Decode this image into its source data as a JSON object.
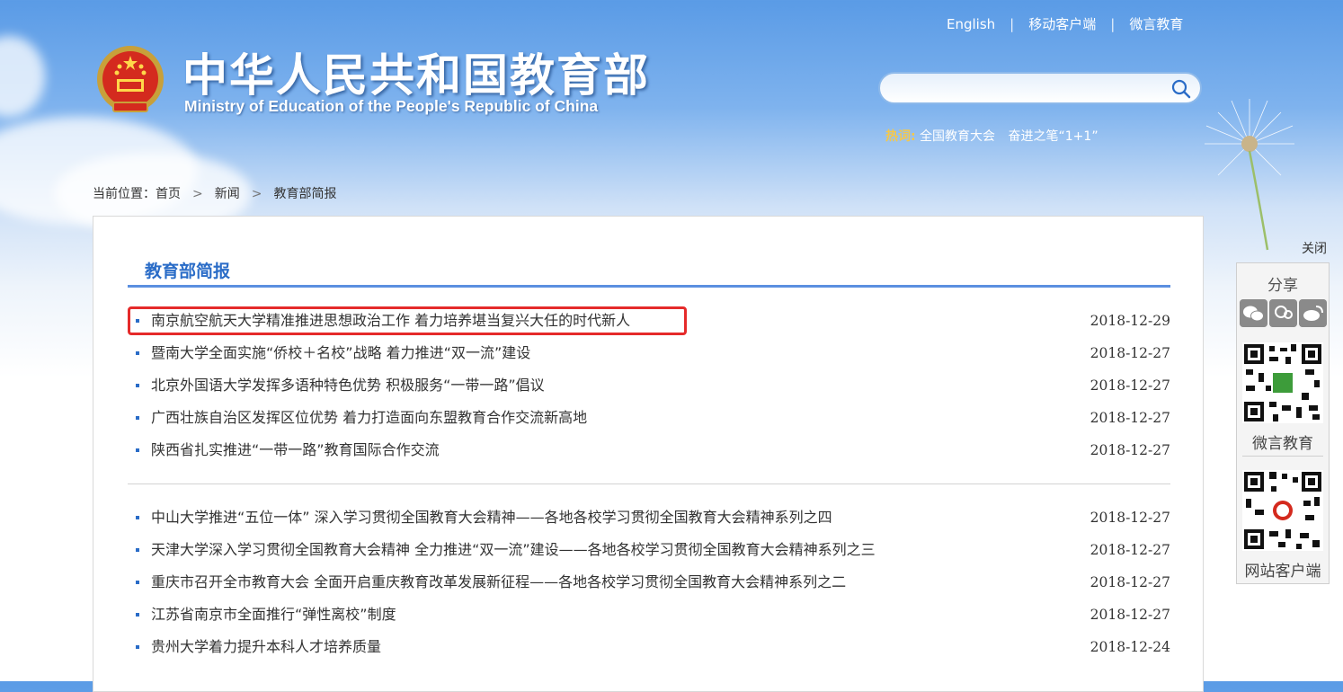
{
  "topnav": {
    "english": "English",
    "mobile_client": "移动客户端",
    "weiyan": "微言教育",
    "separator": "|"
  },
  "site": {
    "title": "中华人民共和国教育部",
    "subtitle": "Ministry of Education of the People's Republic of China"
  },
  "search": {
    "placeholder": "",
    "icon": "search-icon"
  },
  "hotwords": {
    "label": "热词:",
    "items": [
      "全国教育大会",
      "奋进之笔“1+1”"
    ]
  },
  "breadcrumb": {
    "prefix": "当前位置：",
    "home": "首页",
    "news": "新闻",
    "current": "教育部简报",
    "arrow": ">"
  },
  "section": {
    "title": "教育部简报"
  },
  "news_group1": [
    {
      "title": "南京航空航天大学精准推进思想政治工作 着力培养堪当复兴大任的时代新人",
      "date": "2018-12-29"
    },
    {
      "title": "暨南大学全面实施“侨校＋名校”战略 着力推进“双一流”建设",
      "date": "2018-12-27"
    },
    {
      "title": "北京外国语大学发挥多语种特色优势 积极服务“一带一路”倡议",
      "date": "2018-12-27"
    },
    {
      "title": "广西壮族自治区发挥区位优势 着力打造面向东盟教育合作交流新高地",
      "date": "2018-12-27"
    },
    {
      "title": "陕西省扎实推进“一带一路”教育国际合作交流",
      "date": "2018-12-27"
    }
  ],
  "news_group2": [
    {
      "title": "中山大学推进“五位一体” 深入学习贯彻全国教育大会精神——各地各校学习贯彻全国教育大会精神系列之四",
      "date": "2018-12-27"
    },
    {
      "title": "天津大学深入学习贯彻全国教育大会精神 全力推进“双一流”建设——各地各校学习贯彻全国教育大会精神系列之三",
      "date": "2018-12-27"
    },
    {
      "title": "重庆市召开全市教育大会 全面开启重庆教育改革发展新征程——各地各校学习贯彻全国教育大会精神系列之二",
      "date": "2018-12-27"
    },
    {
      "title": "江苏省南京市全面推行“弹性离校”制度",
      "date": "2018-12-27"
    },
    {
      "title": "贵州大学着力提升本科人才培养质量",
      "date": "2018-12-24"
    }
  ],
  "side": {
    "close": "关闭",
    "share": "分享",
    "share_icons": [
      "wechat-icon",
      "qq-icon",
      "weibo-icon"
    ],
    "qr1_label": "微言教育",
    "qr2_label": "网站客户端"
  },
  "colors": {
    "accent": "#2a6cc7",
    "highlight": "#e52a2a",
    "hotword": "#f5c84a"
  }
}
